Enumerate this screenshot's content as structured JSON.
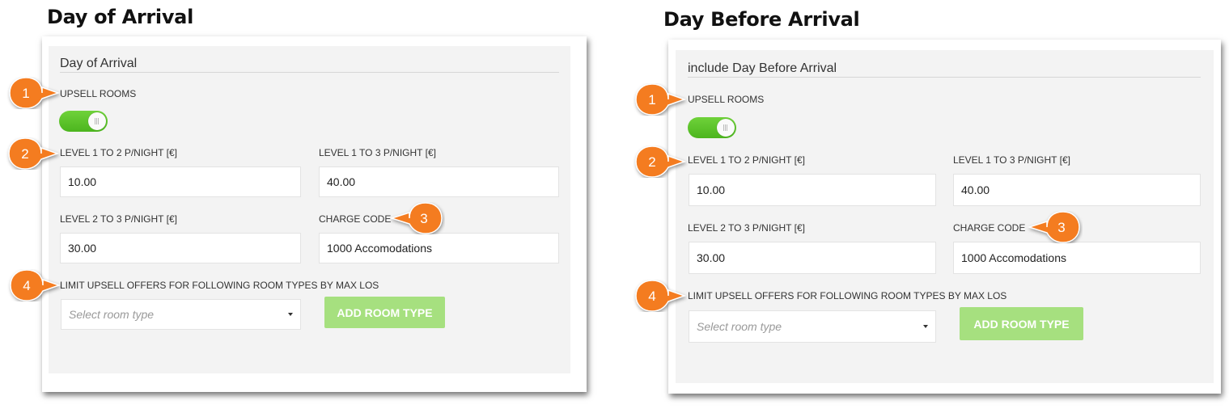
{
  "left": {
    "heading": "Day of Arrival",
    "panel_title": "Day of Arrival",
    "upsell_label": "UPSELL ROOMS",
    "upsell_enabled": true,
    "level_1_2_label": "LEVEL 1 TO 2 P/NIGHT [€]",
    "level_1_2_value": "10.00",
    "level_1_3_label": "LEVEL 1 TO 3 P/NIGHT [€]",
    "level_1_3_value": "40.00",
    "level_2_3_label": "LEVEL 2 TO 3 P/NIGHT [€]",
    "level_2_3_value": "30.00",
    "charge_code_label": "CHARGE CODE",
    "charge_code_value": "1000 Accomodations",
    "limit_label": "LIMIT UPSELL OFFERS FOR FOLLOWING ROOM TYPES BY MAX LOS",
    "select_placeholder": "Select room type",
    "add_button": "ADD ROOM TYPE"
  },
  "right": {
    "heading": "Day Before Arrival",
    "panel_title": "include Day Before Arrival",
    "upsell_label": "UPSELL ROOMS",
    "upsell_enabled": true,
    "level_1_2_label": "LEVEL 1 TO 2 P/NIGHT [€]",
    "level_1_2_value": "10.00",
    "level_1_3_label": "LEVEL 1 TO 3 P/NIGHT [€]",
    "level_1_3_value": "40.00",
    "level_2_3_label": "LEVEL 2 TO 3 P/NIGHT [€]",
    "level_2_3_value": "30.00",
    "charge_code_label": "CHARGE CODE",
    "charge_code_value": "1000 Accomodations",
    "limit_label": "LIMIT UPSELL OFFERS FOR FOLLOWING ROOM TYPES BY MAX LOS",
    "select_placeholder": "Select room type",
    "add_button": "ADD ROOM TYPE"
  },
  "callouts": [
    "1",
    "2",
    "3",
    "4"
  ],
  "colors": {
    "toggle_on": "#5cc42a",
    "button": "#a6e07f",
    "callout": "#f47c20",
    "panel": "#f3f3f3"
  }
}
